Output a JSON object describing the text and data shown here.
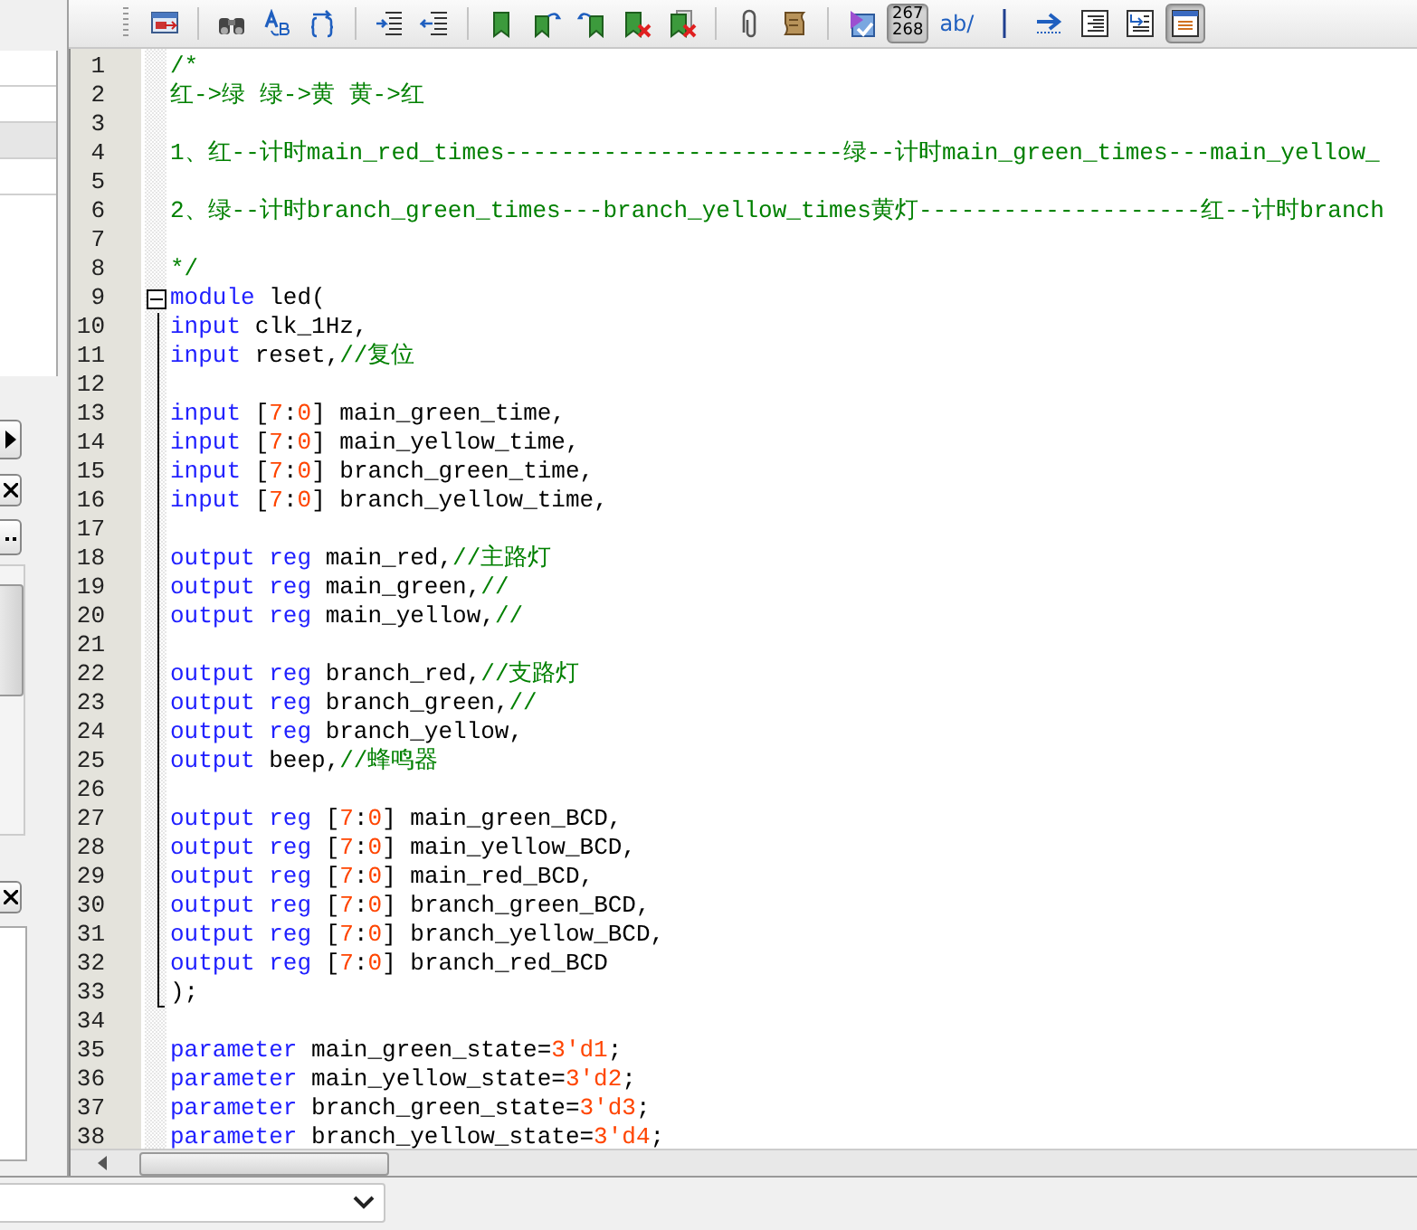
{
  "side_list": [
    {
      "selected": false
    },
    {
      "selected": false
    },
    {
      "selected": true
    },
    {
      "selected": false
    }
  ],
  "toolbar": [
    {
      "kind": "export",
      "pressed": false
    },
    {
      "kind": "separator"
    },
    {
      "kind": "binoculars",
      "pressed": false
    },
    {
      "kind": "replace",
      "pressed": false
    },
    {
      "kind": "braces-arrow",
      "pressed": false
    },
    {
      "kind": "separator"
    },
    {
      "kind": "indent",
      "pressed": false
    },
    {
      "kind": "outdent",
      "pressed": false
    },
    {
      "kind": "separator"
    },
    {
      "kind": "bookmark",
      "pressed": false
    },
    {
      "kind": "bookmark-next",
      "pressed": false
    },
    {
      "kind": "bookmark-prev",
      "pressed": false
    },
    {
      "kind": "bookmark-delete",
      "pressed": false
    },
    {
      "kind": "bookmark-delete-all",
      "pressed": false
    },
    {
      "kind": "separator"
    },
    {
      "kind": "paperclip",
      "pressed": false
    },
    {
      "kind": "scroll",
      "pressed": false
    },
    {
      "kind": "separator"
    },
    {
      "kind": "macro",
      "pressed": false
    },
    {
      "kind": "text",
      "label_lines": [
        "267",
        "268"
      ],
      "pressed": true
    },
    {
      "kind": "text",
      "label_lines": [
        "ab/"
      ],
      "pressed": false
    },
    {
      "kind": "bar",
      "pressed": false
    },
    {
      "kind": "arrow-right",
      "pressed": false
    },
    {
      "kind": "align-right",
      "pressed": false
    },
    {
      "kind": "indent-box",
      "pressed": false
    },
    {
      "kind": "window-lines",
      "pressed": true
    }
  ],
  "editor": {
    "lines": [
      {
        "n": "1",
        "kind": "plain",
        "tokens": [
          {
            "kind": "comment",
            "t": "/*"
          }
        ]
      },
      {
        "n": "2",
        "kind": "plain",
        "tokens": [
          {
            "kind": "comment",
            "t": "红->绿 绿->黄 黄->红"
          }
        ]
      },
      {
        "n": "3",
        "kind": "plain"
      },
      {
        "n": "4",
        "kind": "plain",
        "tokens": [
          {
            "kind": "comment",
            "t": "1、红--计时main_red_times------------------------绿--计时main_green_times---main_yellow_"
          }
        ]
      },
      {
        "n": "5",
        "kind": "plain"
      },
      {
        "n": "6",
        "kind": "plain",
        "tokens": [
          {
            "kind": "comment",
            "t": "2、绿--计时branch_green_times---branch_yellow_times黄灯--------------------红--计时branch"
          }
        ]
      },
      {
        "n": "7",
        "kind": "plain"
      },
      {
        "n": "8",
        "kind": "plain",
        "tokens": [
          {
            "kind": "comment",
            "t": "*/"
          }
        ]
      },
      {
        "n": "9",
        "kind": "fold-start",
        "tokens": [
          {
            "kind": "keyword",
            "t": "module"
          },
          {
            "kind": "plain",
            "t": " led("
          }
        ]
      },
      {
        "n": "10",
        "kind": "fold-body",
        "tokens": [
          {
            "kind": "keyword",
            "t": "input"
          },
          {
            "kind": "plain",
            "t": " clk_1Hz,"
          }
        ]
      },
      {
        "n": "11",
        "kind": "fold-body",
        "tokens": [
          {
            "kind": "keyword",
            "t": "input"
          },
          {
            "kind": "plain",
            "t": " reset,"
          },
          {
            "kind": "comment",
            "t": "//复位"
          }
        ]
      },
      {
        "n": "12",
        "kind": "fold-body"
      },
      {
        "n": "13",
        "kind": "fold-body",
        "tokens": [
          {
            "kind": "keyword",
            "t": "input"
          },
          {
            "kind": "plain",
            "t": " ["
          },
          {
            "kind": "number",
            "t": "7"
          },
          {
            "kind": "plain",
            "t": ":"
          },
          {
            "kind": "number",
            "t": "0"
          },
          {
            "kind": "plain",
            "t": "] main_green_time,"
          }
        ]
      },
      {
        "n": "14",
        "kind": "fold-body",
        "tokens": [
          {
            "kind": "keyword",
            "t": "input"
          },
          {
            "kind": "plain",
            "t": " ["
          },
          {
            "kind": "number",
            "t": "7"
          },
          {
            "kind": "plain",
            "t": ":"
          },
          {
            "kind": "number",
            "t": "0"
          },
          {
            "kind": "plain",
            "t": "] main_yellow_time,"
          }
        ]
      },
      {
        "n": "15",
        "kind": "fold-body",
        "tokens": [
          {
            "kind": "keyword",
            "t": "input"
          },
          {
            "kind": "plain",
            "t": " ["
          },
          {
            "kind": "number",
            "t": "7"
          },
          {
            "kind": "plain",
            "t": ":"
          },
          {
            "kind": "number",
            "t": "0"
          },
          {
            "kind": "plain",
            "t": "] branch_green_time,"
          }
        ]
      },
      {
        "n": "16",
        "kind": "fold-body",
        "tokens": [
          {
            "kind": "keyword",
            "t": "input"
          },
          {
            "kind": "plain",
            "t": " ["
          },
          {
            "kind": "number",
            "t": "7"
          },
          {
            "kind": "plain",
            "t": ":"
          },
          {
            "kind": "number",
            "t": "0"
          },
          {
            "kind": "plain",
            "t": "] branch_yellow_time,"
          }
        ]
      },
      {
        "n": "17",
        "kind": "fold-body"
      },
      {
        "n": "18",
        "kind": "fold-body",
        "tokens": [
          {
            "kind": "keyword",
            "t": "output reg"
          },
          {
            "kind": "plain",
            "t": " main_red,"
          },
          {
            "kind": "comment",
            "t": "//主路灯"
          }
        ]
      },
      {
        "n": "19",
        "kind": "fold-body",
        "tokens": [
          {
            "kind": "keyword",
            "t": "output reg"
          },
          {
            "kind": "plain",
            "t": " main_green,"
          },
          {
            "kind": "comment",
            "t": "//"
          }
        ]
      },
      {
        "n": "20",
        "kind": "fold-body",
        "tokens": [
          {
            "kind": "keyword",
            "t": "output reg"
          },
          {
            "kind": "plain",
            "t": " main_yellow,"
          },
          {
            "kind": "comment",
            "t": "//"
          }
        ]
      },
      {
        "n": "21",
        "kind": "fold-body"
      },
      {
        "n": "22",
        "kind": "fold-body",
        "tokens": [
          {
            "kind": "keyword",
            "t": "output reg"
          },
          {
            "kind": "plain",
            "t": " branch_red,"
          },
          {
            "kind": "comment",
            "t": "//支路灯"
          }
        ]
      },
      {
        "n": "23",
        "kind": "fold-body",
        "tokens": [
          {
            "kind": "keyword",
            "t": "output reg"
          },
          {
            "kind": "plain",
            "t": " branch_green,"
          },
          {
            "kind": "comment",
            "t": "//"
          }
        ]
      },
      {
        "n": "24",
        "kind": "fold-body",
        "tokens": [
          {
            "kind": "keyword",
            "t": "output reg"
          },
          {
            "kind": "plain",
            "t": " branch_yellow,"
          }
        ]
      },
      {
        "n": "25",
        "kind": "fold-body",
        "tokens": [
          {
            "kind": "keyword",
            "t": "output"
          },
          {
            "kind": "plain",
            "t": " beep,"
          },
          {
            "kind": "comment",
            "t": "//蜂鸣器"
          }
        ]
      },
      {
        "n": "26",
        "kind": "fold-body"
      },
      {
        "n": "27",
        "kind": "fold-body",
        "tokens": [
          {
            "kind": "keyword",
            "t": "output reg"
          },
          {
            "kind": "plain",
            "t": " ["
          },
          {
            "kind": "number",
            "t": "7"
          },
          {
            "kind": "plain",
            "t": ":"
          },
          {
            "kind": "number",
            "t": "0"
          },
          {
            "kind": "plain",
            "t": "] main_green_BCD,"
          }
        ]
      },
      {
        "n": "28",
        "kind": "fold-body",
        "tokens": [
          {
            "kind": "keyword",
            "t": "output reg"
          },
          {
            "kind": "plain",
            "t": " ["
          },
          {
            "kind": "number",
            "t": "7"
          },
          {
            "kind": "plain",
            "t": ":"
          },
          {
            "kind": "number",
            "t": "0"
          },
          {
            "kind": "plain",
            "t": "] main_yellow_BCD,"
          }
        ]
      },
      {
        "n": "29",
        "kind": "fold-body",
        "tokens": [
          {
            "kind": "keyword",
            "t": "output reg"
          },
          {
            "kind": "plain",
            "t": " ["
          },
          {
            "kind": "number",
            "t": "7"
          },
          {
            "kind": "plain",
            "t": ":"
          },
          {
            "kind": "number",
            "t": "0"
          },
          {
            "kind": "plain",
            "t": "] main_red_BCD,"
          }
        ]
      },
      {
        "n": "30",
        "kind": "fold-body",
        "tokens": [
          {
            "kind": "keyword",
            "t": "output reg"
          },
          {
            "kind": "plain",
            "t": " ["
          },
          {
            "kind": "number",
            "t": "7"
          },
          {
            "kind": "plain",
            "t": ":"
          },
          {
            "kind": "number",
            "t": "0"
          },
          {
            "kind": "plain",
            "t": "] branch_green_BCD,"
          }
        ]
      },
      {
        "n": "31",
        "kind": "fold-body",
        "tokens": [
          {
            "kind": "keyword",
            "t": "output reg"
          },
          {
            "kind": "plain",
            "t": " ["
          },
          {
            "kind": "number",
            "t": "7"
          },
          {
            "kind": "plain",
            "t": ":"
          },
          {
            "kind": "number",
            "t": "0"
          },
          {
            "kind": "plain",
            "t": "] branch_yellow_BCD,"
          }
        ]
      },
      {
        "n": "32",
        "kind": "fold-body",
        "tokens": [
          {
            "kind": "keyword",
            "t": "output reg"
          },
          {
            "kind": "plain",
            "t": " ["
          },
          {
            "kind": "number",
            "t": "7"
          },
          {
            "kind": "plain",
            "t": ":"
          },
          {
            "kind": "number",
            "t": "0"
          },
          {
            "kind": "plain",
            "t": "] branch_red_BCD"
          }
        ]
      },
      {
        "n": "33",
        "kind": "fold-body",
        "tokens": [
          {
            "kind": "plain",
            "t": ");"
          }
        ]
      },
      {
        "n": "34",
        "kind": "fold-end"
      },
      {
        "n": "35",
        "kind": "plain",
        "tokens": [
          {
            "kind": "keyword",
            "t": "parameter"
          },
          {
            "kind": "plain",
            "t": " main_green_state="
          },
          {
            "kind": "number",
            "t": "3'd1"
          },
          {
            "kind": "plain",
            "t": ";"
          }
        ]
      },
      {
        "n": "36",
        "kind": "plain",
        "tokens": [
          {
            "kind": "keyword",
            "t": "parameter"
          },
          {
            "kind": "plain",
            "t": " main_yellow_state="
          },
          {
            "kind": "number",
            "t": "3'd2"
          },
          {
            "kind": "plain",
            "t": ";"
          }
        ]
      },
      {
        "n": "37",
        "kind": "plain",
        "tokens": [
          {
            "kind": "keyword",
            "t": "parameter"
          },
          {
            "kind": "plain",
            "t": " branch_green_state="
          },
          {
            "kind": "number",
            "t": "3'd3"
          },
          {
            "kind": "plain",
            "t": ";"
          }
        ]
      },
      {
        "n": "38",
        "kind": "plain",
        "tokens": [
          {
            "kind": "keyword",
            "t": "parameter"
          },
          {
            "kind": "plain",
            "t": " branch_yellow_state="
          },
          {
            "kind": "number",
            "t": "3'd4"
          },
          {
            "kind": "plain",
            "t": ";"
          }
        ]
      }
    ]
  }
}
